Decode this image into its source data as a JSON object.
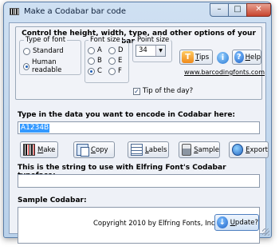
{
  "window": {
    "title": "Make a Codabar bar code"
  },
  "options": {
    "heading": "Control the height, width, type, and other options of your bar code",
    "font_type": {
      "label": "Type of font",
      "opt1": "Standard",
      "opt2": "Human readable"
    },
    "font_size": {
      "label": "Font size",
      "a": "A",
      "b": "B",
      "c": "C",
      "d": "D",
      "e": "E",
      "f": "F"
    },
    "point_size": {
      "label": "Point size",
      "value": "34"
    },
    "tip_of_day": "Tip of the day?",
    "tips_prefix": "T",
    "tips_rest": "ips",
    "help_prefix": "H",
    "help_rest": "elp",
    "url": "www.barcodingfonts.com"
  },
  "data_section": {
    "label": "Type in the data you want to encode in Codabar here:",
    "value": "A1234B"
  },
  "actions": {
    "make_u": "M",
    "make_rest": "ake",
    "copy_u": "C",
    "copy_rest": "opy",
    "labels_u": "L",
    "labels_rest": "abels",
    "sample_u": "S",
    "sample_rest": "ample",
    "export_u": "E",
    "export_rest": "xport"
  },
  "string_section": {
    "label": "This is the string to use with Elfring Font's Codabar typeface:"
  },
  "sample_section": {
    "label": "Sample Codabar:"
  },
  "footer": {
    "copyright": "Copyright 2010 by Elfring Fonts, Inc.",
    "update_u": "U",
    "update_rest": "pdate?"
  }
}
